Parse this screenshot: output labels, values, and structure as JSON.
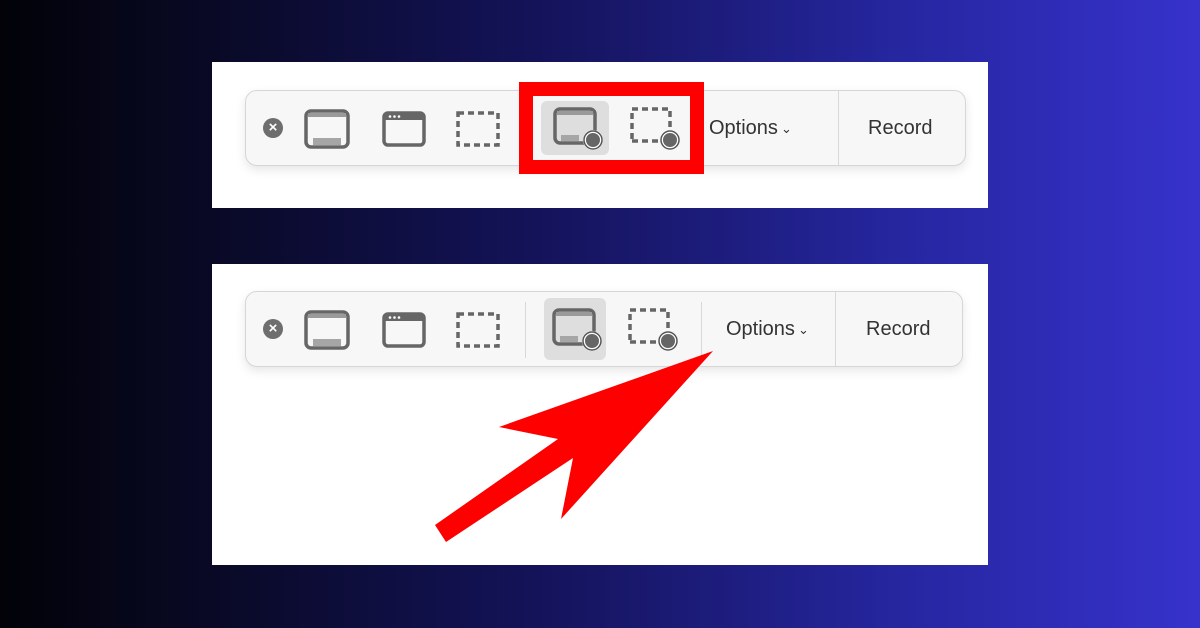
{
  "colors": {
    "highlight": "#ff0000",
    "icon_gray": "#6b6b6b",
    "toolbar_bg": "#f7f7f7",
    "selected_bg": "#dedede"
  },
  "toolbars": [
    {
      "id": "top",
      "close_icon": "×",
      "buttons": [
        {
          "name": "capture-entire-screen",
          "icon": "screen-icon"
        },
        {
          "name": "capture-selected-window",
          "icon": "window-icon"
        },
        {
          "name": "capture-selected-portion",
          "icon": "dashed-selection-icon"
        },
        {
          "name": "record-entire-screen",
          "icon": "screen-record-icon",
          "selected": true
        },
        {
          "name": "record-selected-portion",
          "icon": "dashed-selection-record-icon"
        }
      ],
      "options_label": "Options",
      "chevron": "⌄",
      "record_label": "Record",
      "annotation": "red-highlight-box"
    },
    {
      "id": "bottom",
      "close_icon": "×",
      "buttons": [
        {
          "name": "capture-entire-screen",
          "icon": "screen-icon"
        },
        {
          "name": "capture-selected-window",
          "icon": "window-icon"
        },
        {
          "name": "capture-selected-portion",
          "icon": "dashed-selection-icon"
        },
        {
          "name": "record-entire-screen",
          "icon": "screen-record-icon",
          "selected": true
        },
        {
          "name": "record-selected-portion",
          "icon": "dashed-selection-record-icon"
        }
      ],
      "options_label": "Options",
      "chevron": "⌄",
      "record_label": "Record",
      "annotation": "red-arrow-pointing-to-options"
    }
  ]
}
